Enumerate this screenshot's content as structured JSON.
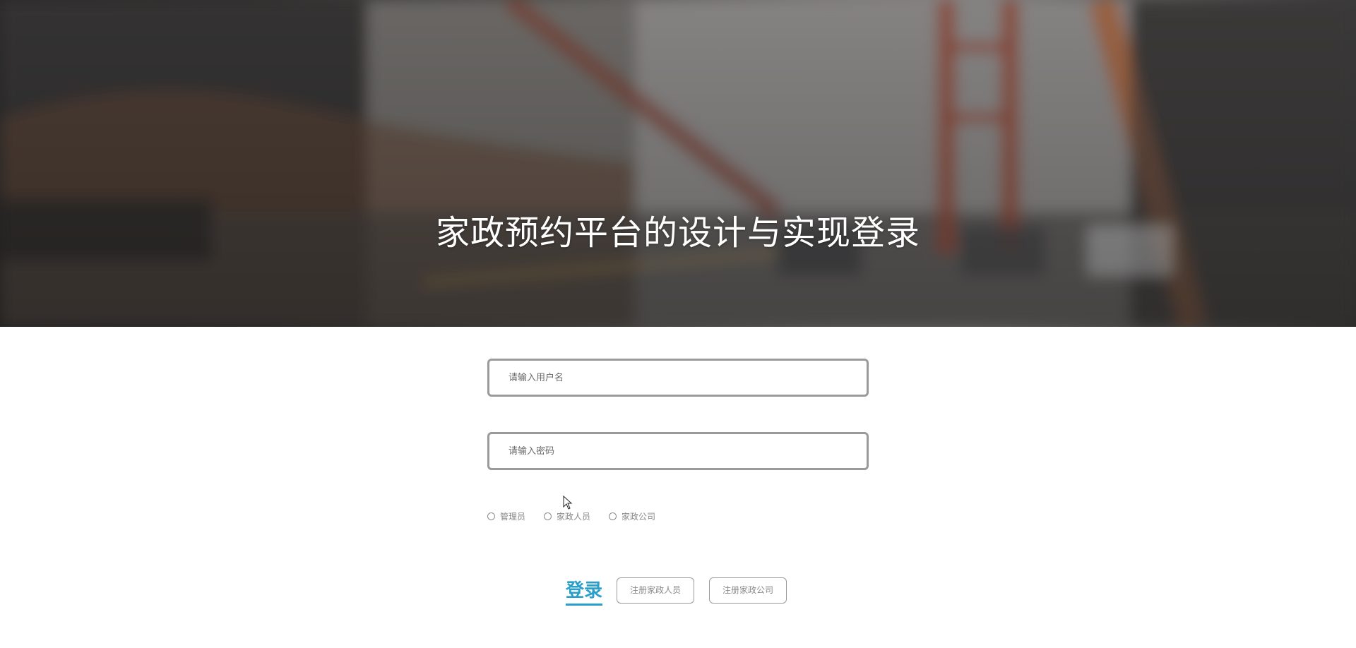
{
  "header": {
    "title": "家政预约平台的设计与实现登录"
  },
  "form": {
    "username_placeholder": "请输入用户名",
    "password_placeholder": "请输入密码",
    "roles": [
      "管理员",
      "家政人员",
      "家政公司"
    ]
  },
  "actions": {
    "login_label": "登录",
    "register_person_label": "注册家政人员",
    "register_company_label": "注册家政公司"
  },
  "colors": {
    "accent": "#2a9fc9"
  },
  "icons": [
    "mouse-cursor-icon",
    "radio-icon"
  ]
}
